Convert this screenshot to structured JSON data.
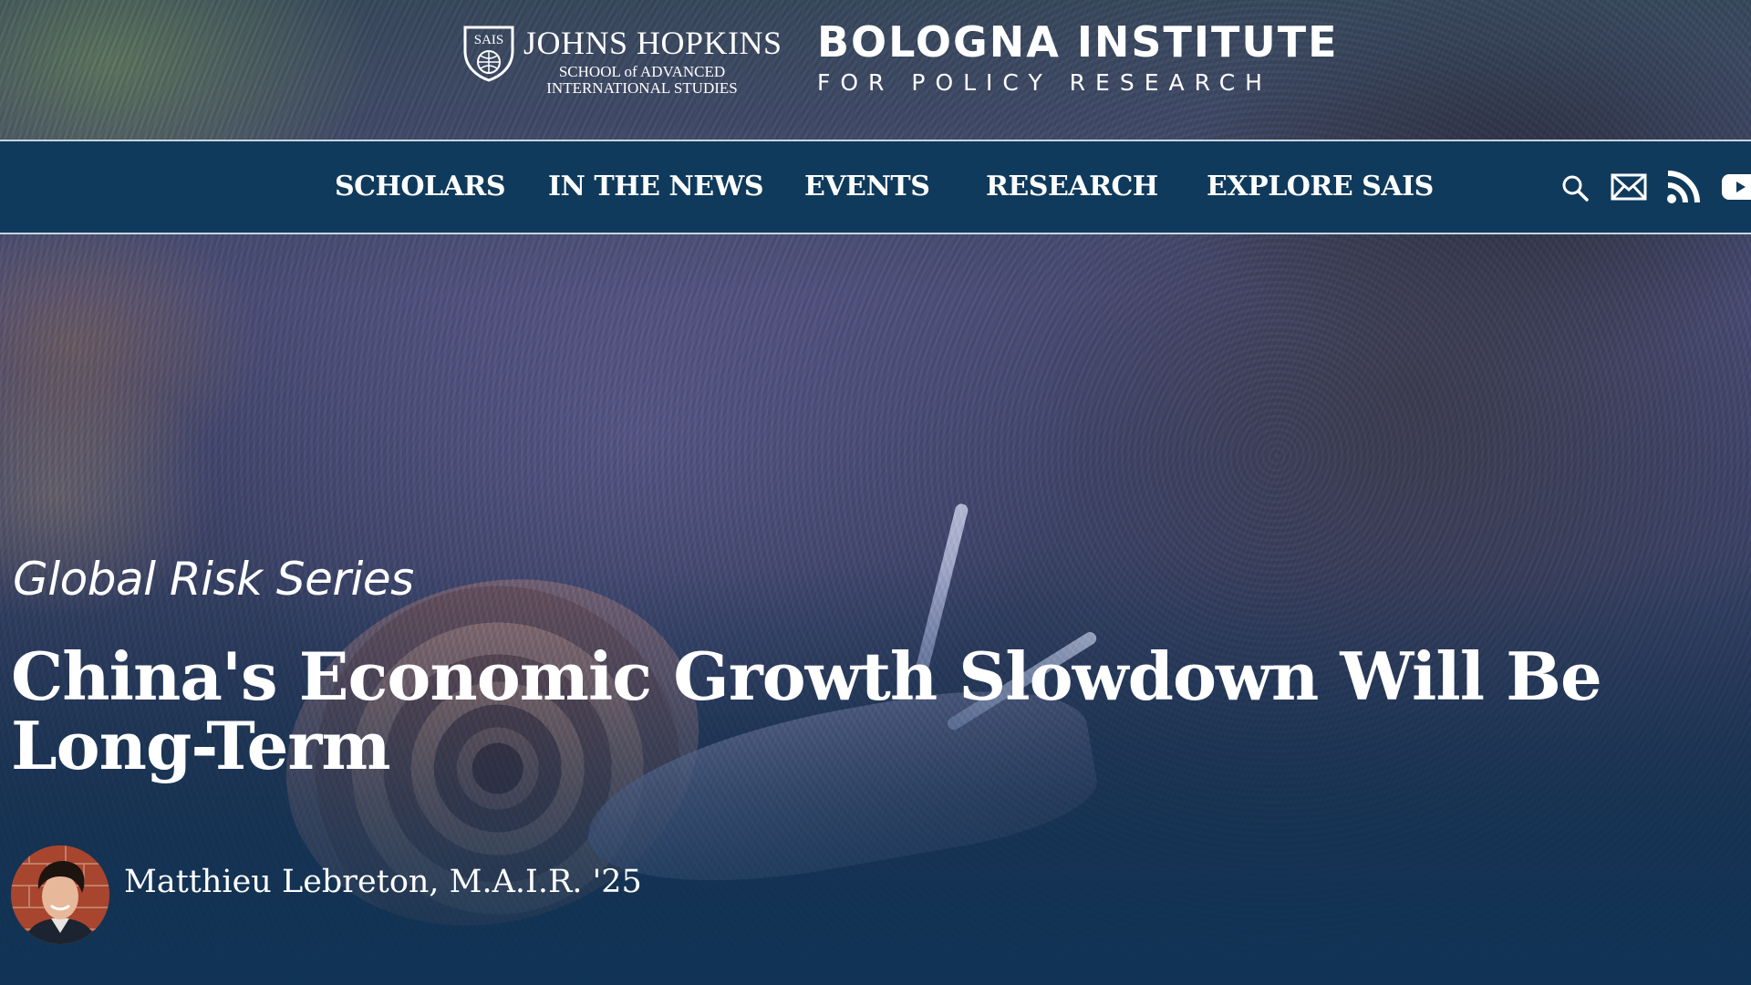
{
  "header": {
    "jh_shield_text": "SAIS",
    "jh_name": "JOHNS HOPKINS",
    "jh_sub_line1": "SCHOOL of ADVANCED",
    "jh_sub_line2": "INTERNATIONAL STUDIES",
    "institute_title": "BOLOGNA INSTITUTE",
    "institute_subtitle": "FOR POLICY RESEARCH"
  },
  "nav": {
    "items": [
      {
        "label": "SCHOLARS"
      },
      {
        "label": "IN THE NEWS"
      },
      {
        "label": "EVENTS"
      },
      {
        "label": "RESEARCH"
      },
      {
        "label": "EXPLORE SAIS"
      }
    ],
    "icons": [
      "search-icon",
      "mail-icon",
      "rss-icon",
      "youtube-icon"
    ]
  },
  "hero": {
    "series": "Global Risk Series",
    "headline": "China's Economic Growth Slowdown Will Be Long-Term",
    "author": "Matthieu Lebreton, M.A.I.R. '25"
  },
  "colors": {
    "nav_background": "#0f3a5c",
    "text": "#ffffff"
  }
}
